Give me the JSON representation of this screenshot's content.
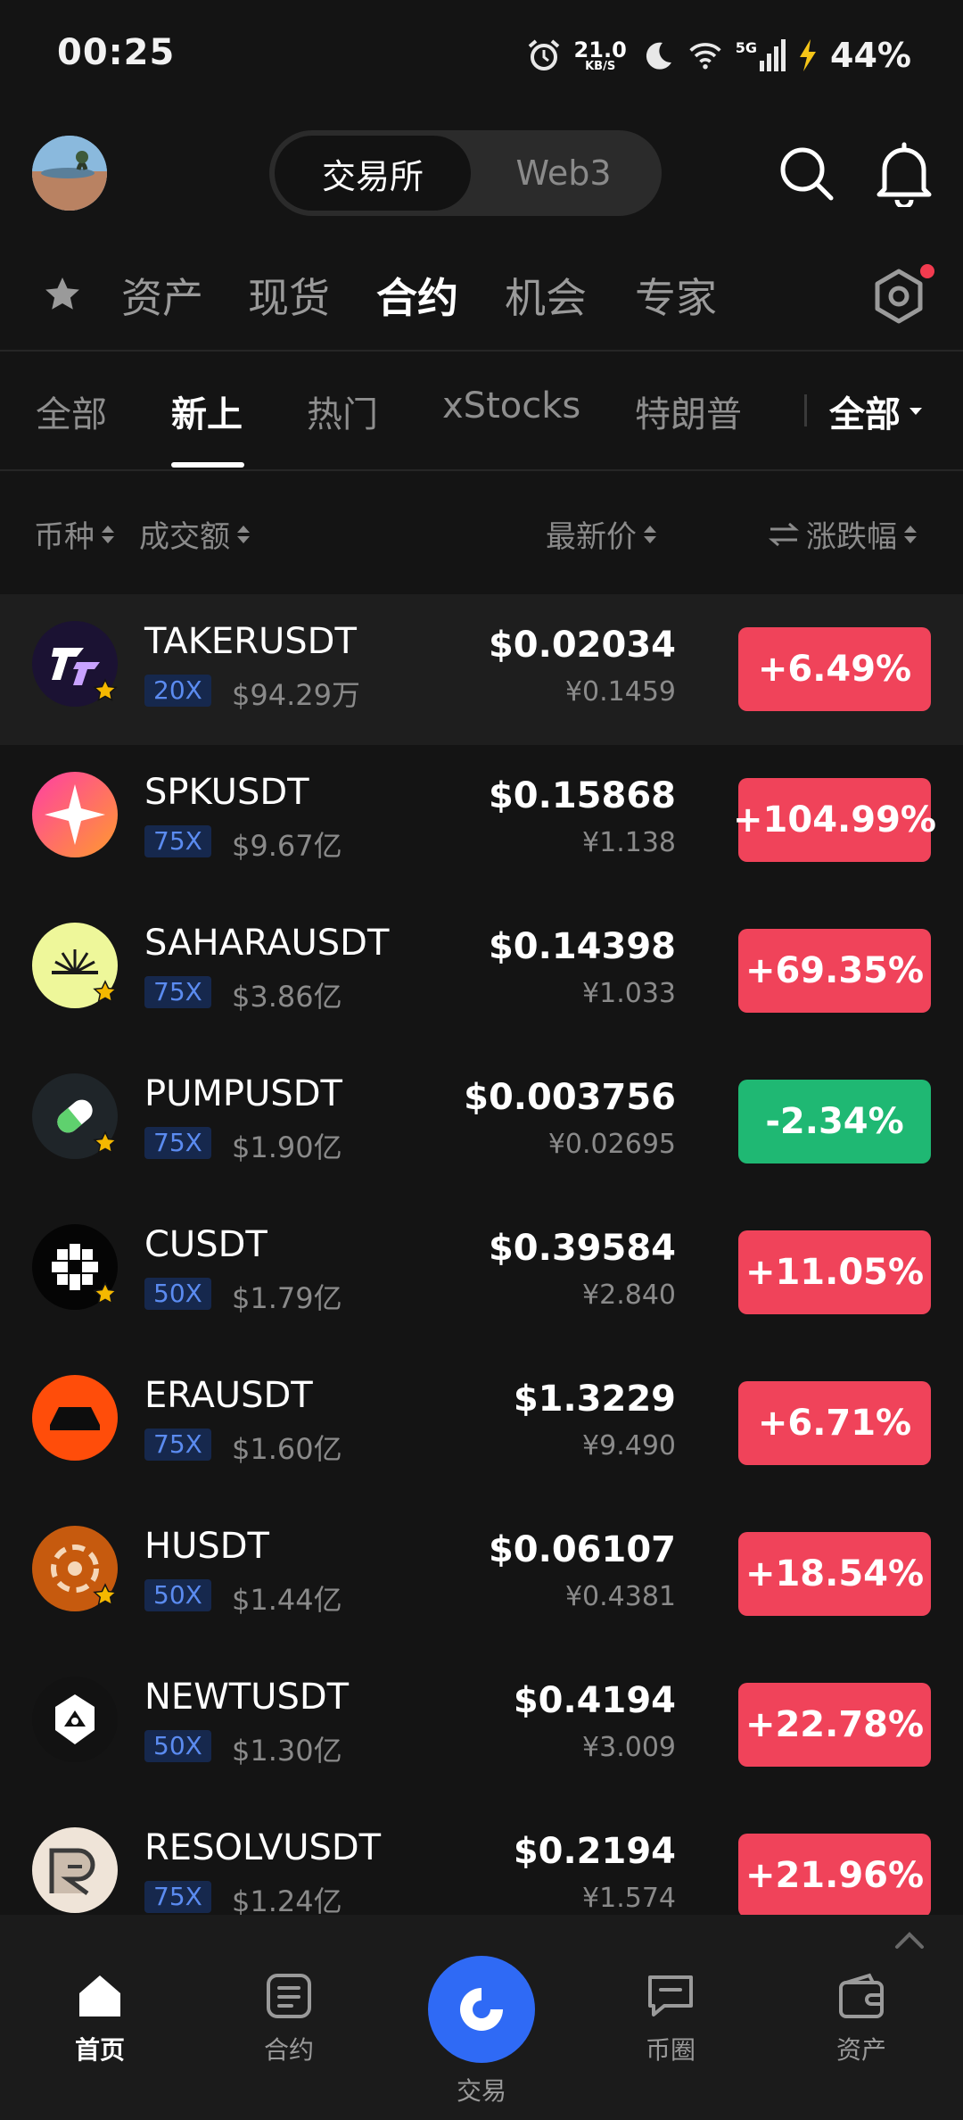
{
  "status_bar": {
    "time": "00:25",
    "net_speed_value": "21.0",
    "net_speed_unit": "KB/S",
    "network": "5G",
    "battery": "44%"
  },
  "header": {
    "segment": [
      "交易所",
      "Web3"
    ],
    "active_segment": "交易所"
  },
  "main_tabs": [
    "资产",
    "现货",
    "合约",
    "机会",
    "专家"
  ],
  "main_tab_active": "合约",
  "sub_tabs": [
    "全部",
    "新上",
    "热门",
    "xStocks",
    "特朗普"
  ],
  "sub_tab_active": "新上",
  "filter_dropdown": "全部",
  "columns": {
    "coin": "币种",
    "volume": "成交额",
    "price": "最新价",
    "change": "涨跌幅"
  },
  "rows": [
    {
      "symbol": "TAKERUSDT",
      "leverage": "20X",
      "volume": "$94.29万",
      "price": "$0.02034",
      "price_cny": "¥0.1459",
      "change": "+6.49%",
      "direction": "up",
      "favorite": true,
      "logo": "taker-logo"
    },
    {
      "symbol": "SPKUSDT",
      "leverage": "75X",
      "volume": "$9.67亿",
      "price": "$0.15868",
      "price_cny": "¥1.138",
      "change": "+104.99%",
      "direction": "up",
      "favorite": false,
      "logo": "spk-logo"
    },
    {
      "symbol": "SAHARAUSDT",
      "leverage": "75X",
      "volume": "$3.86亿",
      "price": "$0.14398",
      "price_cny": "¥1.033",
      "change": "+69.35%",
      "direction": "up",
      "favorite": true,
      "logo": "sahara-logo"
    },
    {
      "symbol": "PUMPUSDT",
      "leverage": "75X",
      "volume": "$1.90亿",
      "price": "$0.003756",
      "price_cny": "¥0.02695",
      "change": "-2.34%",
      "direction": "down",
      "favorite": true,
      "logo": "pump-logo"
    },
    {
      "symbol": "CUSDT",
      "leverage": "50X",
      "volume": "$1.79亿",
      "price": "$0.39584",
      "price_cny": "¥2.840",
      "change": "+11.05%",
      "direction": "up",
      "favorite": true,
      "logo": "c-logo"
    },
    {
      "symbol": "ERAUSDT",
      "leverage": "75X",
      "volume": "$1.60亿",
      "price": "$1.3229",
      "price_cny": "¥9.490",
      "change": "+6.71%",
      "direction": "up",
      "favorite": false,
      "logo": "era-logo"
    },
    {
      "symbol": "HUSDT",
      "leverage": "50X",
      "volume": "$1.44亿",
      "price": "$0.06107",
      "price_cny": "¥0.4381",
      "change": "+18.54%",
      "direction": "up",
      "favorite": true,
      "logo": "h-logo"
    },
    {
      "symbol": "NEWTUSDT",
      "leverage": "50X",
      "volume": "$1.30亿",
      "price": "$0.4194",
      "price_cny": "¥3.009",
      "change": "+22.78%",
      "direction": "up",
      "favorite": false,
      "logo": "newt-logo"
    },
    {
      "symbol": "RESOLVUSDT",
      "leverage": "75X",
      "volume": "$1.24亿",
      "price": "$0.2194",
      "price_cny": "¥1.574",
      "change": "+21.96%",
      "direction": "up",
      "favorite": false,
      "logo": "resolv-logo"
    }
  ],
  "bottom_nav": [
    "首页",
    "合约",
    "交易",
    "币圈",
    "资产"
  ],
  "bottom_nav_active": "首页",
  "colors": {
    "background": "#141414",
    "up": "#f0435a",
    "down": "#1fb873",
    "accent": "#2f6af5",
    "leverage_text": "#5b8bf0"
  }
}
